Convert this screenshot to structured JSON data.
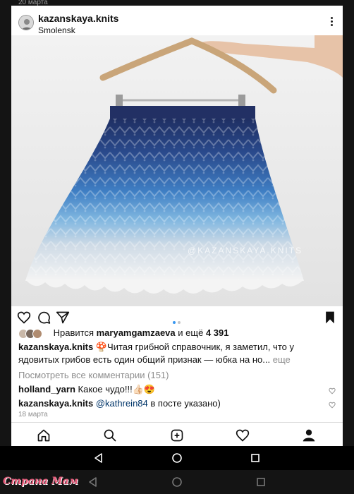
{
  "top_date": "20 марта",
  "post": {
    "username": "kazanskaya.knits",
    "location": "Smolensk",
    "watermark": "@KAZANSKAYA.KNITS",
    "likes": {
      "prefix": "Нравится",
      "user": "maryamgamzaeva",
      "middle": "и ещё",
      "count": "4 391"
    },
    "caption": {
      "user": "kazanskaya.knits",
      "emoji": "🍄",
      "text": "Читая грибной справочник, я заметил, что у ядовитых грибов есть один общий признак — юбка на но...",
      "more": "еще"
    },
    "view_all": "Посмотреть все комментарии (151)",
    "comments": [
      {
        "user": "holland_yarn",
        "text": "Какое чудо!!!👍🏻😍"
      },
      {
        "user": "kazanskaya.knits",
        "mention": "@kathrein84",
        "text": "в посте указано)"
      }
    ],
    "date": "18 марта"
  },
  "icons": {
    "like": "heart-icon",
    "comment": "comment-icon",
    "share": "send-icon",
    "save": "bookmark-icon",
    "more": "more-vertical-icon",
    "home": "home-icon",
    "search": "search-icon",
    "add": "add-post-icon",
    "activity": "heart-icon",
    "profile": "profile-icon"
  },
  "colors": {
    "link": "#003569",
    "muted": "#8e8e8e",
    "carousel_active": "#3897f0"
  },
  "site_logo": "Страна Мам"
}
